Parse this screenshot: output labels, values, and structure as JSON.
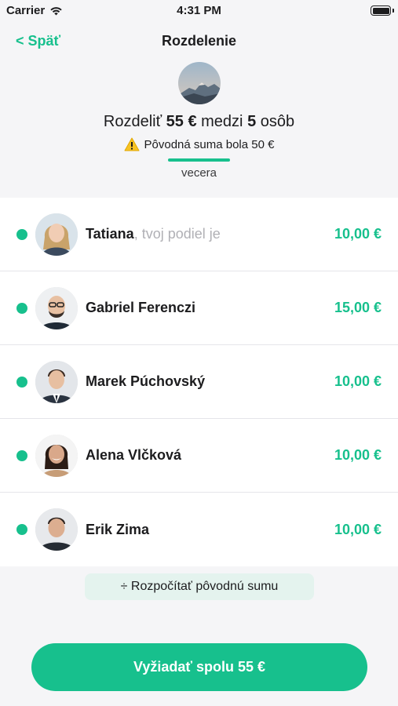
{
  "status_bar": {
    "carrier": "Carrier",
    "time": "4:31 PM",
    "wifi_icon": "wifi-icon",
    "battery_icon": "battery-icon"
  },
  "nav": {
    "back_label": "< Späť",
    "title": "Rozdelenie"
  },
  "summary": {
    "prefix": "Rozdeliť",
    "amount": "55 €",
    "middle": "medzi",
    "count": "5",
    "suffix": "osôb",
    "warning_icon": "warning-icon",
    "warning_text": "Pôvodná suma bola 50 €",
    "tab_label": "vecera"
  },
  "people": [
    {
      "name": "Tatiana",
      "suffix": ", tvoj podiel je",
      "amount": "10,00 €"
    },
    {
      "name": "Gabriel Ferenczi",
      "suffix": "",
      "amount": "15,00 €"
    },
    {
      "name": "Marek Púchovský",
      "suffix": "",
      "amount": "10,00 €"
    },
    {
      "name": "Alena Vlčková",
      "suffix": "",
      "amount": "10,00 €"
    },
    {
      "name": "Erik Zima",
      "suffix": "",
      "amount": "10,00 €"
    }
  ],
  "recalc_label": "÷ Rozpočítať pôvodnú sumu",
  "cta_label": "Vyžiadať spolu 55 €",
  "colors": {
    "accent": "#17c08d",
    "background": "#f5f5f7"
  }
}
